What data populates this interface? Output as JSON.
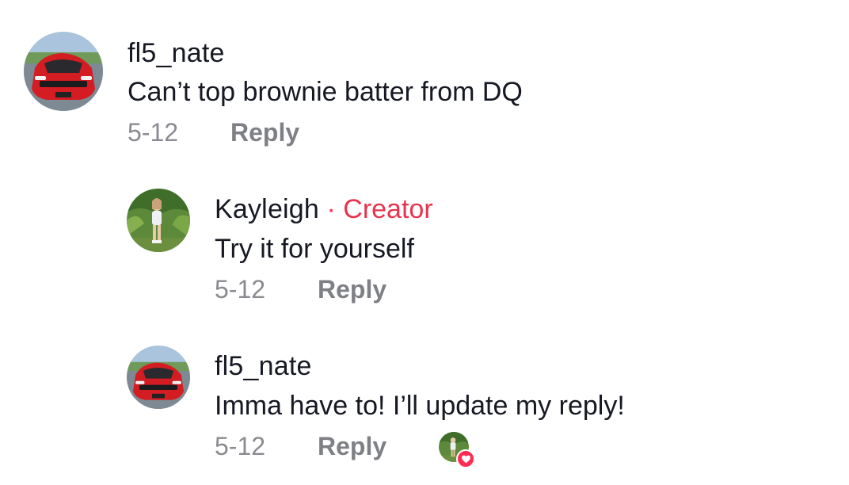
{
  "colors": {
    "creator_accent": "#fe2c55",
    "text_primary": "#161823",
    "text_secondary": "#8a8b91"
  },
  "comments": [
    {
      "username": "fl5_nate",
      "text": "Can’t top brownie batter from DQ",
      "date": "5-12",
      "reply_label": "Reply",
      "avatar_icon": "red-car-avatar"
    },
    {
      "username": "Kayleigh",
      "separator": "·",
      "badge": "Creator",
      "text": "Try it for yourself",
      "date": "5-12",
      "reply_label": "Reply",
      "avatar_icon": "person-garden-avatar"
    },
    {
      "username": "fl5_nate",
      "text": "Imma have to! I’ll update my reply!",
      "date": "5-12",
      "reply_label": "Reply",
      "avatar_icon": "red-car-avatar",
      "creator_liked": true,
      "liked_icon": "heart-icon"
    }
  ]
}
